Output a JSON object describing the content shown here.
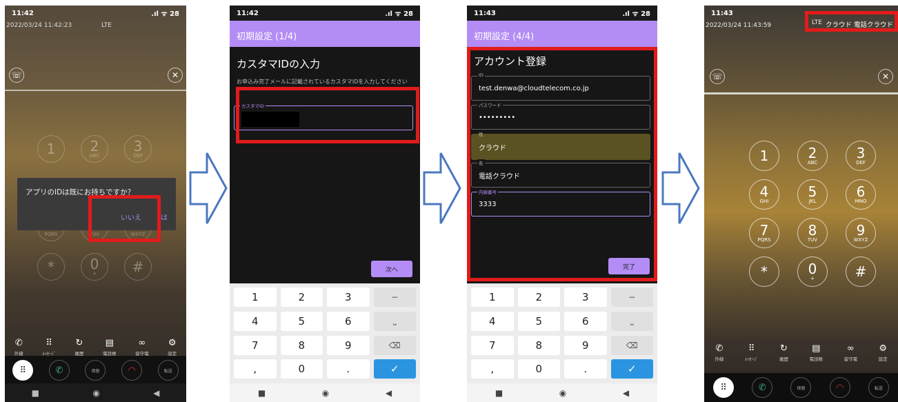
{
  "phone1": {
    "time": "11:42",
    "status_right": ".ıl ᯤ 28",
    "datetime": "2022/03/24 11:42:23",
    "network": "LTE",
    "dialog": {
      "message": "アプリのIDは既にお持ちですか？",
      "no": "いいえ",
      "yes": "は"
    },
    "keys": [
      {
        "d": "1",
        "s": ""
      },
      {
        "d": "2",
        "s": "ABC"
      },
      {
        "d": "3",
        "s": "DEF"
      },
      {
        "d": "7",
        "s": "PQRS"
      },
      {
        "d": "8",
        "s": "TUV"
      },
      {
        "d": "9",
        "s": "WXYZ"
      },
      {
        "d": "*",
        "s": ""
      },
      {
        "d": "0",
        "s": "+"
      },
      {
        "d": "#",
        "s": ""
      }
    ],
    "toolbar": [
      "外線",
      "ﾒｯｾｰｼﾞ",
      "履歴",
      "電話帳",
      "留守電",
      "設定"
    ],
    "call_buttons": [
      "保留",
      "転送"
    ]
  },
  "phone2": {
    "time": "11:42",
    "status_right": ".ıl ᯤ 28",
    "title": "初期設定 (1/4)",
    "heading": "カスタマIDの入力",
    "description": "お申込み完了メールに記載されているカスタマIDを入力してください",
    "field_label": "カスタマID",
    "next": "次へ",
    "keyboard": [
      "1",
      "2",
      "3",
      "−",
      "4",
      "5",
      "6",
      "⎵",
      "7",
      "8",
      "9",
      "⌫",
      ",",
      "0",
      ".",
      "✓"
    ]
  },
  "phone3": {
    "time": "11:43",
    "status_right": ".ıl ᯤ 28",
    "title": "初期設定 (4/4)",
    "heading": "アカウント登録",
    "fields": [
      {
        "label": "ID",
        "value": "test.denwa@cloudtelecom.co.jp"
      },
      {
        "label": "パスワード",
        "value": "•••••••••"
      },
      {
        "label": "姓",
        "value": "クラウド"
      },
      {
        "label": "名",
        "value": "電話クラウド"
      },
      {
        "label": "内線番号",
        "value": "3333"
      }
    ],
    "done": "完了",
    "keyboard": [
      "1",
      "2",
      "3",
      "−",
      "4",
      "5",
      "6",
      "⎵",
      "7",
      "8",
      "9",
      "⌫",
      ",",
      "0",
      ".",
      "✓"
    ]
  },
  "phone4": {
    "time": "11:43",
    "datetime": "2022/03/24 11:43:59",
    "network": "LTE",
    "account": "クラウド 電話クラウド",
    "keys": [
      {
        "d": "1",
        "s": ""
      },
      {
        "d": "2",
        "s": "ABC"
      },
      {
        "d": "3",
        "s": "DEF"
      },
      {
        "d": "4",
        "s": "GHI"
      },
      {
        "d": "5",
        "s": "JKL"
      },
      {
        "d": "6",
        "s": "MNO"
      },
      {
        "d": "7",
        "s": "PQRS"
      },
      {
        "d": "8",
        "s": "TUV"
      },
      {
        "d": "9",
        "s": "WXYZ"
      },
      {
        "d": "*",
        "s": ""
      },
      {
        "d": "0",
        "s": "+"
      },
      {
        "d": "#",
        "s": ""
      }
    ],
    "toolbar": [
      "外線",
      "ﾒｯｾｰｼﾞ",
      "履歴",
      "電話帳",
      "留守電",
      "設定"
    ],
    "call_buttons": [
      "保留",
      "転送"
    ]
  },
  "colors": {
    "accent": "#b48cf5",
    "highlight": "#e21b1b",
    "arrow": "#4a78c0",
    "check": "#2b94e0"
  }
}
